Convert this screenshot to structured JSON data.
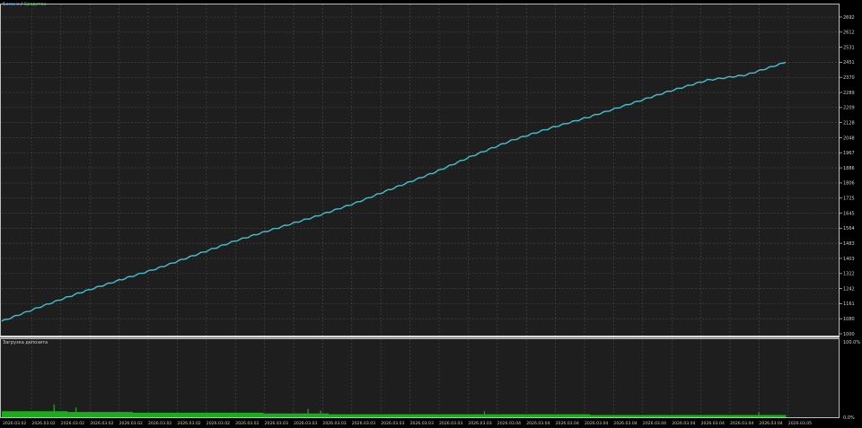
{
  "legend": {
    "series_a": "Баланс",
    "separator": "/",
    "series_b": "Средства"
  },
  "subwindow": {
    "title": "Загрузка депозита"
  },
  "colors": {
    "background": "#1e1e1e",
    "grid": "#4a4a4a",
    "frame": "#bdbdbd",
    "balance_line": "#3fc2cf",
    "deposit_bars": "#1fa91f",
    "axis_text": "#d0d0d0"
  },
  "chart_data": [
    {
      "type": "line",
      "series": [
        {
          "name": "Баланс",
          "x": [
            0,
            5,
            10,
            15,
            20,
            25,
            30,
            35,
            40,
            45,
            50,
            55,
            60,
            65,
            70,
            75,
            80,
            85,
            90,
            95,
            100
          ],
          "values": [
            1000,
            1082,
            1160,
            1230,
            1298,
            1376,
            1453,
            1520,
            1586,
            1660,
            1746,
            1830,
            1925,
            2012,
            2082,
            2145,
            2215,
            2286,
            2350,
            2380,
            2450
          ]
        }
      ],
      "ylim": [
        1000,
        2450
      ],
      "y_ticks": [
        "2692",
        "2612",
        "2531",
        "2451",
        "2370",
        "2289",
        "2209",
        "2128",
        "2048",
        "1967",
        "1886",
        "1806",
        "1725",
        "1645",
        "1564",
        "1483",
        "1403",
        "1322",
        "1242",
        "1161",
        "1080",
        "1000"
      ],
      "grid": true
    },
    {
      "type": "bar",
      "title": "Загрузка депозита",
      "y_ticks": [
        "100.0%",
        "0.0%"
      ],
      "ylim": [
        0,
        100
      ],
      "x_ticks": [
        "2026.03.02",
        "2026.03.02",
        "2026.03.02",
        "2026.03.02",
        "2026.03.02",
        "2026.03.02",
        "2026.03.02",
        "2026.03.02",
        "2026.03.02",
        "2026.03.03",
        "2026.03.03",
        "2026.03.03",
        "2026.03.03",
        "2026.03.03",
        "2026.03.03",
        "2026.03.03",
        "2026.03.03",
        "2026.03.04",
        "2026.03.04",
        "2026.03.04",
        "2026.03.04",
        "2026.03.04",
        "2026.03.04",
        "2026.03.04",
        "2026.03.04",
        "2026.03.04",
        "2026.03.04",
        "2026.03.05"
      ],
      "baseline_levels": [
        8,
        7,
        6,
        6,
        5,
        4,
        4,
        4,
        4,
        3,
        3,
        3
      ],
      "spikes": [
        {
          "x": 6.6,
          "value": 17
        },
        {
          "x": 9.4,
          "value": 13
        },
        {
          "x": 39.0,
          "value": 11
        },
        {
          "x": 40.6,
          "value": 9
        },
        {
          "x": 61.5,
          "value": 8
        },
        {
          "x": 96.5,
          "value": 7
        }
      ],
      "grid": true
    }
  ]
}
